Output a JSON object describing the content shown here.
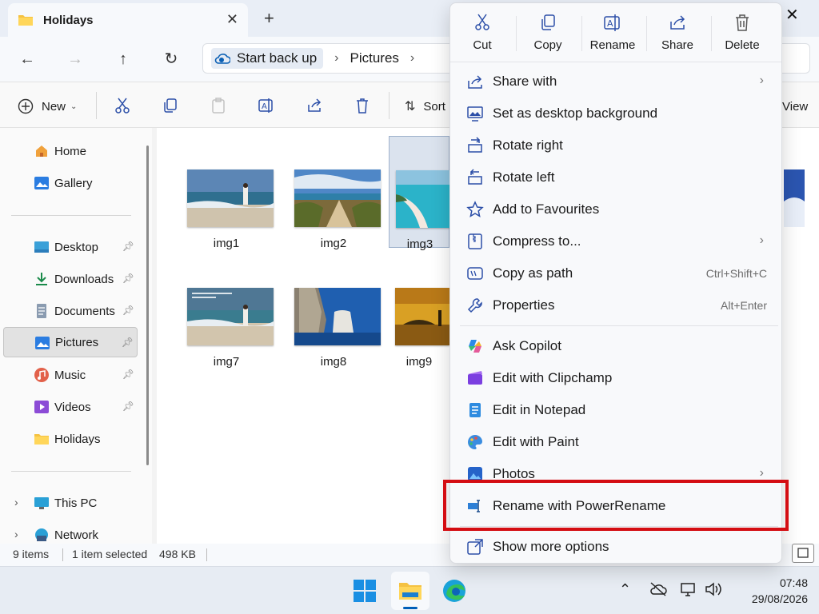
{
  "window": {
    "tab_title": "Holidays",
    "close_tab": "✕",
    "new_tab": "+",
    "close_window": "✕"
  },
  "nav": {
    "back": "←",
    "forward": "→",
    "up": "↑",
    "refresh": "↻",
    "breadcrumb": [
      "Start back up",
      "Pictures"
    ],
    "separator": "›"
  },
  "commandbar": {
    "new_label": "New",
    "sort_label": "Sort",
    "view_label": "View"
  },
  "sidebar": {
    "items": [
      {
        "label": "Home",
        "icon": "home-icon"
      },
      {
        "label": "Gallery",
        "icon": "gallery-icon"
      },
      {
        "label": "Desktop",
        "icon": "desktop-icon",
        "pinned": true
      },
      {
        "label": "Downloads",
        "icon": "downloads-icon",
        "pinned": true
      },
      {
        "label": "Documents",
        "icon": "documents-icon",
        "pinned": true
      },
      {
        "label": "Pictures",
        "icon": "pictures-icon",
        "pinned": true,
        "selected": true
      },
      {
        "label": "Music",
        "icon": "music-icon",
        "pinned": true
      },
      {
        "label": "Videos",
        "icon": "videos-icon",
        "pinned": true
      },
      {
        "label": "Holidays",
        "icon": "folder-icon"
      },
      {
        "label": "This PC",
        "icon": "pc-icon"
      },
      {
        "label": "Network",
        "icon": "network-icon"
      }
    ]
  },
  "files": [
    {
      "name": "img1"
    },
    {
      "name": "img2"
    },
    {
      "name": "img3",
      "selected": true
    },
    {
      "name": "img7"
    },
    {
      "name": "img8"
    },
    {
      "name": "img9"
    }
  ],
  "status": {
    "count": "9 items",
    "selected": "1 item selected",
    "size": "498 KB"
  },
  "context_menu": {
    "quick_actions": [
      {
        "label": "Cut",
        "icon": "cut-icon"
      },
      {
        "label": "Copy",
        "icon": "copy-icon"
      },
      {
        "label": "Rename",
        "icon": "rename-icon"
      },
      {
        "label": "Share",
        "icon": "share-icon"
      },
      {
        "label": "Delete",
        "icon": "delete-icon"
      }
    ],
    "items": [
      {
        "label": "Share with",
        "icon": "share-with-icon",
        "submenu": true
      },
      {
        "label": "Set as desktop background",
        "icon": "desktop-background-icon"
      },
      {
        "label": "Rotate right",
        "icon": "rotate-right-icon"
      },
      {
        "label": "Rotate left",
        "icon": "rotate-left-icon"
      },
      {
        "label": "Add to Favourites",
        "icon": "star-icon"
      },
      {
        "label": "Compress to...",
        "icon": "compress-icon",
        "submenu": true
      },
      {
        "label": "Copy as path",
        "icon": "copy-path-icon",
        "shortcut": "Ctrl+Shift+C"
      },
      {
        "label": "Properties",
        "icon": "properties-icon",
        "shortcut": "Alt+Enter"
      },
      {
        "label": "Ask Copilot",
        "icon": "copilot-icon"
      },
      {
        "label": "Edit with Clipchamp",
        "icon": "clipchamp-icon"
      },
      {
        "label": "Edit in Notepad",
        "icon": "notepad-icon"
      },
      {
        "label": "Edit with Paint",
        "icon": "paint-icon"
      },
      {
        "label": "Photos",
        "icon": "photos-icon",
        "submenu": true
      },
      {
        "label": "Rename with PowerRename",
        "icon": "powerrename-icon"
      },
      {
        "label": "Show more options",
        "icon": "show-more-icon"
      }
    ],
    "submenu_chevron": "›"
  },
  "taskbar": {
    "time": "07:48",
    "date": "29/08/2026"
  },
  "colors": {
    "accent": "#005fb8",
    "highlight_box": "#d40d12",
    "menu_bg": "#f8f9fb"
  }
}
